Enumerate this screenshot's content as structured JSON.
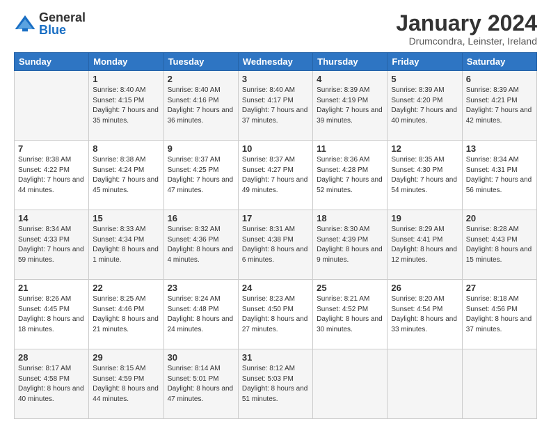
{
  "header": {
    "logo_general": "General",
    "logo_blue": "Blue",
    "month_title": "January 2024",
    "subtitle": "Drumcondra, Leinster, Ireland"
  },
  "days_of_week": [
    "Sunday",
    "Monday",
    "Tuesday",
    "Wednesday",
    "Thursday",
    "Friday",
    "Saturday"
  ],
  "weeks": [
    [
      {
        "day": "",
        "sunrise": "",
        "sunset": "",
        "daylight": ""
      },
      {
        "day": "1",
        "sunrise": "Sunrise: 8:40 AM",
        "sunset": "Sunset: 4:15 PM",
        "daylight": "Daylight: 7 hours and 35 minutes."
      },
      {
        "day": "2",
        "sunrise": "Sunrise: 8:40 AM",
        "sunset": "Sunset: 4:16 PM",
        "daylight": "Daylight: 7 hours and 36 minutes."
      },
      {
        "day": "3",
        "sunrise": "Sunrise: 8:40 AM",
        "sunset": "Sunset: 4:17 PM",
        "daylight": "Daylight: 7 hours and 37 minutes."
      },
      {
        "day": "4",
        "sunrise": "Sunrise: 8:39 AM",
        "sunset": "Sunset: 4:19 PM",
        "daylight": "Daylight: 7 hours and 39 minutes."
      },
      {
        "day": "5",
        "sunrise": "Sunrise: 8:39 AM",
        "sunset": "Sunset: 4:20 PM",
        "daylight": "Daylight: 7 hours and 40 minutes."
      },
      {
        "day": "6",
        "sunrise": "Sunrise: 8:39 AM",
        "sunset": "Sunset: 4:21 PM",
        "daylight": "Daylight: 7 hours and 42 minutes."
      }
    ],
    [
      {
        "day": "7",
        "sunrise": "Sunrise: 8:38 AM",
        "sunset": "Sunset: 4:22 PM",
        "daylight": "Daylight: 7 hours and 44 minutes."
      },
      {
        "day": "8",
        "sunrise": "Sunrise: 8:38 AM",
        "sunset": "Sunset: 4:24 PM",
        "daylight": "Daylight: 7 hours and 45 minutes."
      },
      {
        "day": "9",
        "sunrise": "Sunrise: 8:37 AM",
        "sunset": "Sunset: 4:25 PM",
        "daylight": "Daylight: 7 hours and 47 minutes."
      },
      {
        "day": "10",
        "sunrise": "Sunrise: 8:37 AM",
        "sunset": "Sunset: 4:27 PM",
        "daylight": "Daylight: 7 hours and 49 minutes."
      },
      {
        "day": "11",
        "sunrise": "Sunrise: 8:36 AM",
        "sunset": "Sunset: 4:28 PM",
        "daylight": "Daylight: 7 hours and 52 minutes."
      },
      {
        "day": "12",
        "sunrise": "Sunrise: 8:35 AM",
        "sunset": "Sunset: 4:30 PM",
        "daylight": "Daylight: 7 hours and 54 minutes."
      },
      {
        "day": "13",
        "sunrise": "Sunrise: 8:34 AM",
        "sunset": "Sunset: 4:31 PM",
        "daylight": "Daylight: 7 hours and 56 minutes."
      }
    ],
    [
      {
        "day": "14",
        "sunrise": "Sunrise: 8:34 AM",
        "sunset": "Sunset: 4:33 PM",
        "daylight": "Daylight: 7 hours and 59 minutes."
      },
      {
        "day": "15",
        "sunrise": "Sunrise: 8:33 AM",
        "sunset": "Sunset: 4:34 PM",
        "daylight": "Daylight: 8 hours and 1 minute."
      },
      {
        "day": "16",
        "sunrise": "Sunrise: 8:32 AM",
        "sunset": "Sunset: 4:36 PM",
        "daylight": "Daylight: 8 hours and 4 minutes."
      },
      {
        "day": "17",
        "sunrise": "Sunrise: 8:31 AM",
        "sunset": "Sunset: 4:38 PM",
        "daylight": "Daylight: 8 hours and 6 minutes."
      },
      {
        "day": "18",
        "sunrise": "Sunrise: 8:30 AM",
        "sunset": "Sunset: 4:39 PM",
        "daylight": "Daylight: 8 hours and 9 minutes."
      },
      {
        "day": "19",
        "sunrise": "Sunrise: 8:29 AM",
        "sunset": "Sunset: 4:41 PM",
        "daylight": "Daylight: 8 hours and 12 minutes."
      },
      {
        "day": "20",
        "sunrise": "Sunrise: 8:28 AM",
        "sunset": "Sunset: 4:43 PM",
        "daylight": "Daylight: 8 hours and 15 minutes."
      }
    ],
    [
      {
        "day": "21",
        "sunrise": "Sunrise: 8:26 AM",
        "sunset": "Sunset: 4:45 PM",
        "daylight": "Daylight: 8 hours and 18 minutes."
      },
      {
        "day": "22",
        "sunrise": "Sunrise: 8:25 AM",
        "sunset": "Sunset: 4:46 PM",
        "daylight": "Daylight: 8 hours and 21 minutes."
      },
      {
        "day": "23",
        "sunrise": "Sunrise: 8:24 AM",
        "sunset": "Sunset: 4:48 PM",
        "daylight": "Daylight: 8 hours and 24 minutes."
      },
      {
        "day": "24",
        "sunrise": "Sunrise: 8:23 AM",
        "sunset": "Sunset: 4:50 PM",
        "daylight": "Daylight: 8 hours and 27 minutes."
      },
      {
        "day": "25",
        "sunrise": "Sunrise: 8:21 AM",
        "sunset": "Sunset: 4:52 PM",
        "daylight": "Daylight: 8 hours and 30 minutes."
      },
      {
        "day": "26",
        "sunrise": "Sunrise: 8:20 AM",
        "sunset": "Sunset: 4:54 PM",
        "daylight": "Daylight: 8 hours and 33 minutes."
      },
      {
        "day": "27",
        "sunrise": "Sunrise: 8:18 AM",
        "sunset": "Sunset: 4:56 PM",
        "daylight": "Daylight: 8 hours and 37 minutes."
      }
    ],
    [
      {
        "day": "28",
        "sunrise": "Sunrise: 8:17 AM",
        "sunset": "Sunset: 4:58 PM",
        "daylight": "Daylight: 8 hours and 40 minutes."
      },
      {
        "day": "29",
        "sunrise": "Sunrise: 8:15 AM",
        "sunset": "Sunset: 4:59 PM",
        "daylight": "Daylight: 8 hours and 44 minutes."
      },
      {
        "day": "30",
        "sunrise": "Sunrise: 8:14 AM",
        "sunset": "Sunset: 5:01 PM",
        "daylight": "Daylight: 8 hours and 47 minutes."
      },
      {
        "day": "31",
        "sunrise": "Sunrise: 8:12 AM",
        "sunset": "Sunset: 5:03 PM",
        "daylight": "Daylight: 8 hours and 51 minutes."
      },
      {
        "day": "",
        "sunrise": "",
        "sunset": "",
        "daylight": ""
      },
      {
        "day": "",
        "sunrise": "",
        "sunset": "",
        "daylight": ""
      },
      {
        "day": "",
        "sunrise": "",
        "sunset": "",
        "daylight": ""
      }
    ]
  ]
}
